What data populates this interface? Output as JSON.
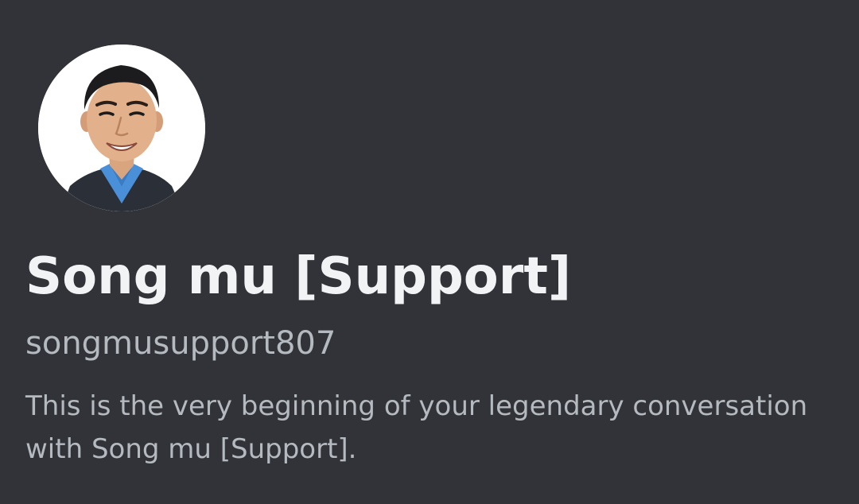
{
  "profile": {
    "display_name": "Song mu [Support]",
    "username": "songmusupport807",
    "intro_text": "This is the very beginning of your legendary conversation with Song mu [Support]."
  },
  "icons": {
    "avatar": "user-photo-avatar"
  },
  "colors": {
    "background": "#313338",
    "display_name": "#f2f3f5",
    "secondary_text": "#b5bac1"
  }
}
